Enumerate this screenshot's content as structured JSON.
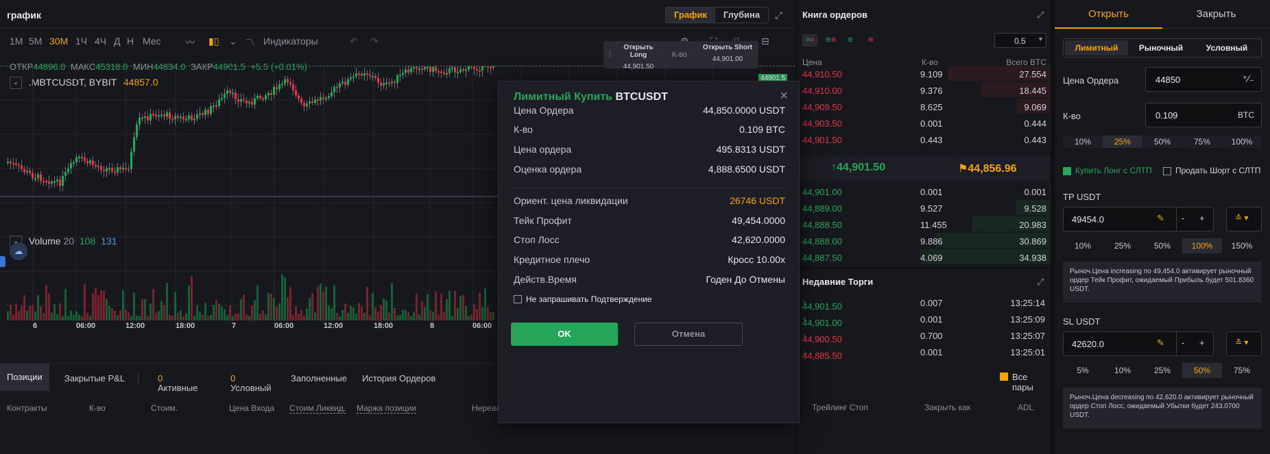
{
  "chart": {
    "title": "график",
    "view_tabs": [
      "График",
      "Глубина"
    ],
    "timeframes": [
      "1М",
      "5М",
      "30М",
      "1Ч",
      "4Ч",
      "Д",
      "Н",
      "Мес"
    ],
    "indicators_label": "Индикаторы",
    "ohlc": {
      "open_label": "ОТКР",
      "open": "44896.0",
      "high_label": "МАКС",
      "high": "45318.0",
      "low_label": "МИН",
      "low": "44834.0",
      "close_label": "ЗАКР",
      "close": "44901.5",
      "change": "+5.5 (+0.01%)"
    },
    "symbol": ".MBTCUSDT, BYBIT",
    "symbol_price": "44857.0",
    "volume_label": "Volume",
    "volume_params": [
      "20",
      "108",
      "131"
    ],
    "open_long": {
      "label": "Открыть Long",
      "price": "44,901.50"
    },
    "open_short": {
      "label": "Открыть Short",
      "price": "44,901.00"
    },
    "qty_label": "К-во",
    "price_tag": "44901.5",
    "time_ticks": [
      "6",
      "06:00",
      "12:00",
      "18:00",
      "7",
      "06:00",
      "12:00",
      "18:00",
      "8",
      "06:00"
    ]
  },
  "bottom": {
    "tabs": [
      "Позиции",
      "Закрытые P&L",
      "Активные",
      "Условный",
      "Заполненные",
      "История Ордеров"
    ],
    "active_count": "0",
    "conditional_count": "0",
    "all_pairs": "Все пары",
    "columns": [
      "Контракты",
      "К-во",
      "Стоим.",
      "Цена Входа",
      "Стоим.Ликвид.",
      "Маржа позиции",
      "Нереал",
      "Трейлинг Стоп",
      "Закрыть как",
      "ADL"
    ]
  },
  "orderbook": {
    "title": "Книга ордеров",
    "precision": "0.5",
    "headers": [
      "Цена",
      "К-во",
      "Всего BTC"
    ],
    "asks": [
      [
        "44,910.50",
        "9.109",
        "27.554"
      ],
      [
        "44,910.00",
        "9.376",
        "18.445"
      ],
      [
        "44,909.50",
        "8.625",
        "9.069"
      ],
      [
        "44,903.50",
        "0.001",
        "0.444"
      ],
      [
        "44,901.50",
        "0.443",
        "0.443"
      ]
    ],
    "last_price": "44,901.50",
    "mark_price": "44,856.96",
    "bids": [
      [
        "44,901.00",
        "0.001",
        "0.001"
      ],
      [
        "44,889.00",
        "9.527",
        "9.528"
      ],
      [
        "44,888.50",
        "11.455",
        "20.983"
      ],
      [
        "44,888.00",
        "9.886",
        "30.869"
      ],
      [
        "44,887.50",
        "4.069",
        "34.938"
      ]
    ]
  },
  "trades": {
    "title": "Недавние Торги",
    "rows": [
      [
        "44,901.50",
        "0.007",
        "13:25:14"
      ],
      [
        "44,901.00",
        "0.001",
        "13:25:09"
      ],
      [
        "44,900.50",
        "0.700",
        "13:25:07"
      ],
      [
        "44,885.50",
        "0.001",
        "13:25:01"
      ]
    ]
  },
  "order_panel": {
    "tabs": [
      "Открыть",
      "Закрыть"
    ],
    "types": [
      "Лимитный",
      "Рыночный",
      "Условный"
    ],
    "price_label": "Цена Ордера",
    "price_value": "44850",
    "qty_label": "К-во",
    "qty_value": "0.109",
    "qty_unit": "BTC",
    "qty_pcts": [
      "10%",
      "25%",
      "50%",
      "75%",
      "100%"
    ],
    "buy_long": "Купить Лонг с СЛТП",
    "sell_short": "Продать Шорт с СЛТП",
    "tp_label": "TP USDT",
    "tp_value": "49454.0",
    "tp_pcts": [
      "10%",
      "25%",
      "50%",
      "100%",
      "150%"
    ],
    "tp_note": "Рыноч.Цена increasing по 49,454.0 активирует рыночный ордер Тейк Профит, ожидаемый Прибыль будет 501.8360 USDT.",
    "sl_label": "SL USDT",
    "sl_value": "42620.0",
    "sl_pcts": [
      "5%",
      "10%",
      "25%",
      "50%",
      "75%"
    ],
    "sl_note": "Рыноч.Цена decreasing по 42,620.0 активирует рыночный ордер Стоп Лосс, ожидаемый Убытки будет 243.0700 USDT."
  },
  "modal": {
    "title_prefix": "Лимитный Купить",
    "symbol": "BTCUSDT",
    "rows": [
      {
        "label": "Цена Ордера",
        "value": "44,850.0000 USDT"
      },
      {
        "label": "К-во",
        "value": "0.109 BTC"
      },
      {
        "label": "Цена ордера",
        "value": "495.8313 USDT"
      },
      {
        "label": "Оценка ордера",
        "value": "4,888.6500 USDT"
      },
      {
        "label": "Ориент. цена ликвидации",
        "value": "26746 USDT"
      },
      {
        "label": "Тейк Профит",
        "value": "49,454.0000"
      },
      {
        "label": "Стоп Лосс",
        "value": "42,620.0000"
      },
      {
        "label": "Кредитное плечо",
        "value": "Кросс 10.00x"
      },
      {
        "label": "Действ.Время",
        "value": "Годен До Отмены"
      }
    ],
    "dont_ask": "Не запрашивать Подтверждение",
    "ok": "OK",
    "cancel": "Отмена"
  }
}
